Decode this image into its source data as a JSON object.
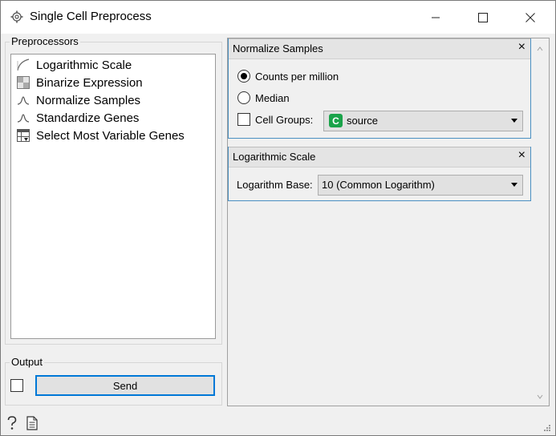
{
  "window": {
    "title": "Single Cell Preprocess"
  },
  "left": {
    "preprocessors_title": "Preprocessors",
    "items": [
      {
        "label": "Logarithmic Scale",
        "icon": "log-curve-icon"
      },
      {
        "label": "Binarize Expression",
        "icon": "checker-icon"
      },
      {
        "label": "Normalize Samples",
        "icon": "bell-curve-icon"
      },
      {
        "label": "Standardize Genes",
        "icon": "bell-curve-icon"
      },
      {
        "label": "Select Most Variable Genes",
        "icon": "table-filter-icon"
      }
    ],
    "output_title": "Output",
    "send_label": "Send"
  },
  "normalize": {
    "title": "Normalize Samples",
    "close": "×",
    "option_cpm": "Counts per million",
    "option_median": "Median",
    "cell_groups_label": "Cell Groups:",
    "cell_groups_badge": "C",
    "cell_groups_value": "source"
  },
  "logscale": {
    "title": "Logarithmic Scale",
    "close": "×",
    "base_label": "Logarithm Base:",
    "base_value": "10 (Common Logarithm)"
  },
  "status": {
    "help_icon": "question-icon",
    "report_icon": "document-icon"
  }
}
